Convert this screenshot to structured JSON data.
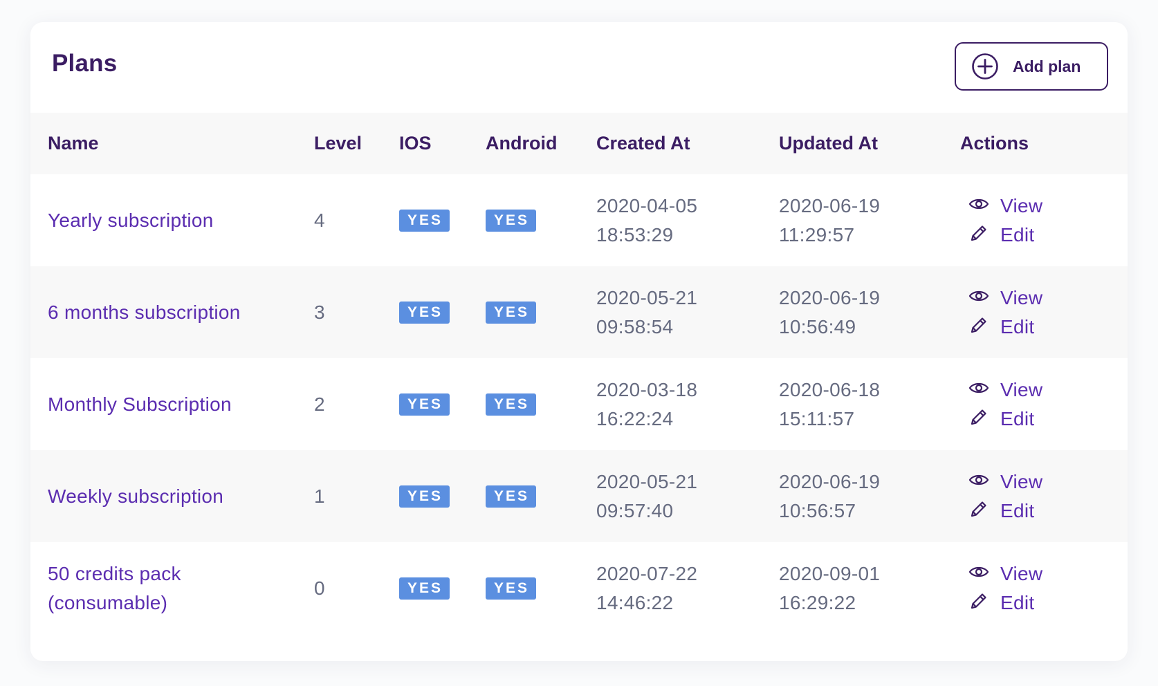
{
  "header": {
    "title": "Plans",
    "add_button_label": "Add plan",
    "add_icon": "plus-circle-icon"
  },
  "table": {
    "columns": [
      "Name",
      "Level",
      "IOS",
      "Android",
      "Created At",
      "Updated At",
      "Actions"
    ],
    "rows": [
      {
        "name": "Yearly subscription",
        "level": "4",
        "ios": "YES",
        "android": "YES",
        "created_date": "2020-04-05",
        "created_time": "18:53:29",
        "updated_date": "2020-06-19",
        "updated_time": "11:29:57",
        "view": "View",
        "edit": "Edit"
      },
      {
        "name": "6 months subscription",
        "level": "3",
        "ios": "YES",
        "android": "YES",
        "created_date": "2020-05-21",
        "created_time": "09:58:54",
        "updated_date": "2020-06-19",
        "updated_time": "10:56:49",
        "view": "View",
        "edit": "Edit"
      },
      {
        "name": "Monthly Subscription",
        "level": "2",
        "ios": "YES",
        "android": "YES",
        "created_date": "2020-03-18",
        "created_time": "16:22:24",
        "updated_date": "2020-06-18",
        "updated_time": "15:11:57",
        "view": "View",
        "edit": "Edit"
      },
      {
        "name": "Weekly subscription",
        "level": "1",
        "ios": "YES",
        "android": "YES",
        "created_date": "2020-05-21",
        "created_time": "09:57:40",
        "updated_date": "2020-06-19",
        "updated_time": "10:56:57",
        "view": "View",
        "edit": "Edit"
      },
      {
        "name_line1": "50 credits pack",
        "name_line2": "(consumable)",
        "level": "0",
        "ios": "YES",
        "android": "YES",
        "created_date": "2020-07-22",
        "created_time": "14:46:22",
        "updated_date": "2020-09-01",
        "updated_time": "16:29:22",
        "view": "View",
        "edit": "Edit"
      }
    ]
  },
  "icons": {
    "view": "eye-icon",
    "edit": "pencil-icon"
  },
  "colors": {
    "primary": "#3b1d63",
    "link": "#5b2db0",
    "badge": "#5b8fe0",
    "muted_text": "#666b80",
    "stripe": "#f8f8f8"
  }
}
